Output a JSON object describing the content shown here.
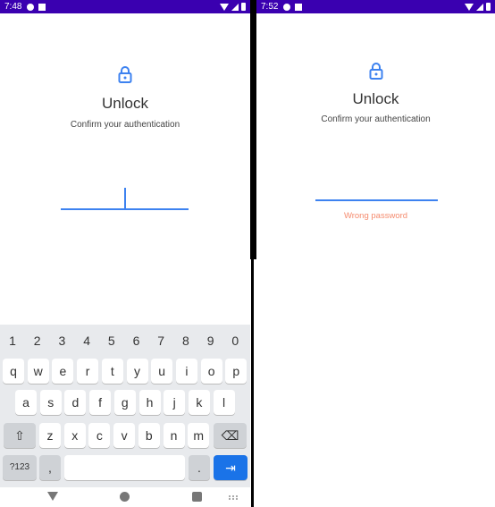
{
  "left": {
    "status": {
      "time": "7:48"
    },
    "title": "Unlock",
    "subtitle": "Confirm your authentication",
    "password_value": ""
  },
  "right": {
    "status": {
      "time": "7:52"
    },
    "title": "Unlock",
    "subtitle": "Confirm your authentication",
    "password_value": "",
    "error": "Wrong password"
  },
  "keyboard": {
    "numbers": [
      "1",
      "2",
      "3",
      "4",
      "5",
      "6",
      "7",
      "8",
      "9",
      "0"
    ],
    "row1": [
      "q",
      "w",
      "e",
      "r",
      "t",
      "y",
      "u",
      "i",
      "o",
      "p"
    ],
    "row2": [
      "a",
      "s",
      "d",
      "f",
      "g",
      "h",
      "j",
      "k",
      "l"
    ],
    "row3": [
      "z",
      "x",
      "c",
      "v",
      "b",
      "n",
      "m"
    ],
    "symbols_label": "?123",
    "comma": ",",
    "period": "."
  },
  "colors": {
    "accent": "#3d82f0",
    "status_bar": "#3a00b0",
    "error": "#f58b6e",
    "enter_key": "#1a73e8"
  }
}
